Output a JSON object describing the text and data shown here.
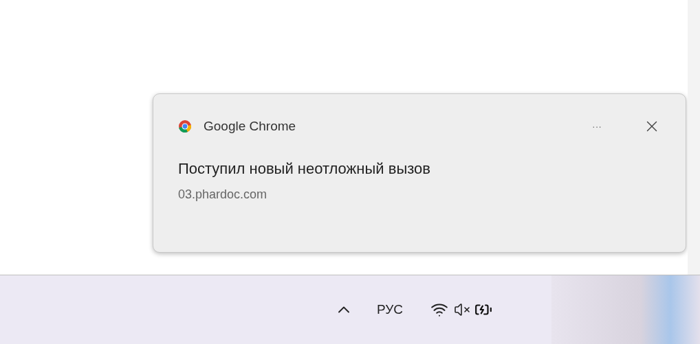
{
  "notification": {
    "app_name": "Google Chrome",
    "more_label": "···",
    "title": "Поступил новый неотложный вызов",
    "source": "03.phardoc.com"
  },
  "taskbar": {
    "language": "РУС"
  }
}
